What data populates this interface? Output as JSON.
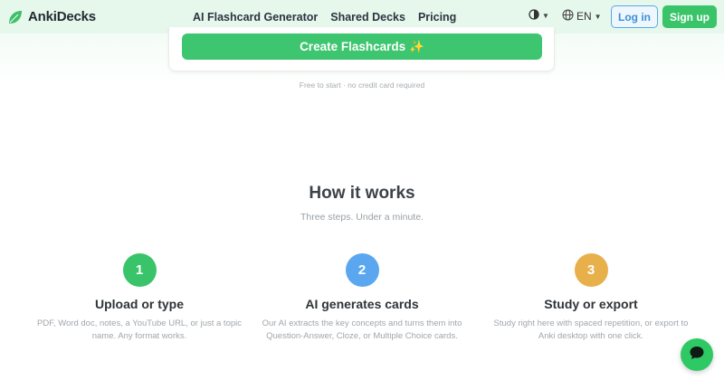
{
  "brand": {
    "name": "AnkiDecks"
  },
  "nav": {
    "links": [
      "AI Flashcard Generator",
      "Shared Decks",
      "Pricing"
    ]
  },
  "controls": {
    "language": "EN",
    "login_label": "Log in",
    "signup_label": "Sign up"
  },
  "hero": {
    "create_label": "Create Flashcards",
    "sparkle": "✨",
    "free_note": "Free to start · no credit card required"
  },
  "how": {
    "title": "How it works",
    "subtitle": "Three steps. Under a minute.",
    "steps": [
      {
        "number": "1",
        "title": "Upload or type",
        "desc": "PDF, Word doc, notes, a YouTube URL, or just a topic name. Any format works.",
        "color": "#39c46a"
      },
      {
        "number": "2",
        "title": "AI generates cards",
        "desc": "Our AI extracts the key concepts and turns them into Question-Answer, Cloze, or Multiple Choice cards.",
        "color": "#5aa7f0"
      },
      {
        "number": "3",
        "title": "Study or export",
        "desc": "Study right here with spaced repetition, or export to Anki desktop with one click.",
        "color": "#e8b04a"
      }
    ]
  },
  "colors": {
    "accent": "#39c46a",
    "nav_bg": "#e6f7ec",
    "login_border": "#5aa7e8"
  },
  "icons": {
    "logo": "leaf-icon",
    "theme": "half-circle-icon",
    "language": "globe-icon",
    "chat": "chat-bubble-icon"
  }
}
